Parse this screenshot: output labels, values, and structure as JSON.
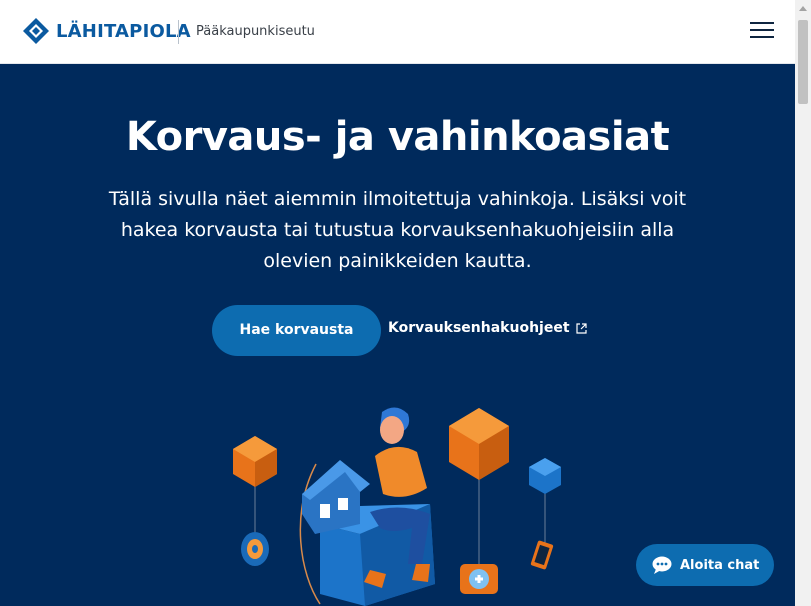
{
  "header": {
    "brand": "LÄHITAPIOLA",
    "region": "Pääkaupunkiseutu",
    "menu_icon": "hamburger-menu-icon",
    "brand_color": "#0b5aa0"
  },
  "hero": {
    "title": "Korvaus- ja vahinkoasiat",
    "description": "Tällä sivulla näet aiemmin ilmoitettuja vahinkoja. Lisäksi voit hakea korvausta tai tutustua korvauksenhakuohjeisiin alla olevien painikkeiden kautta.",
    "primary_button": "Hae korvausta",
    "guide_link": "Korvauksenhakuohjeet",
    "guide_link_icon": "external-link-icon",
    "background": "#002a5c",
    "accent": "#0d6cb0"
  },
  "chat": {
    "label": "Aloita chat",
    "icon": "chat-bubble-icon"
  }
}
